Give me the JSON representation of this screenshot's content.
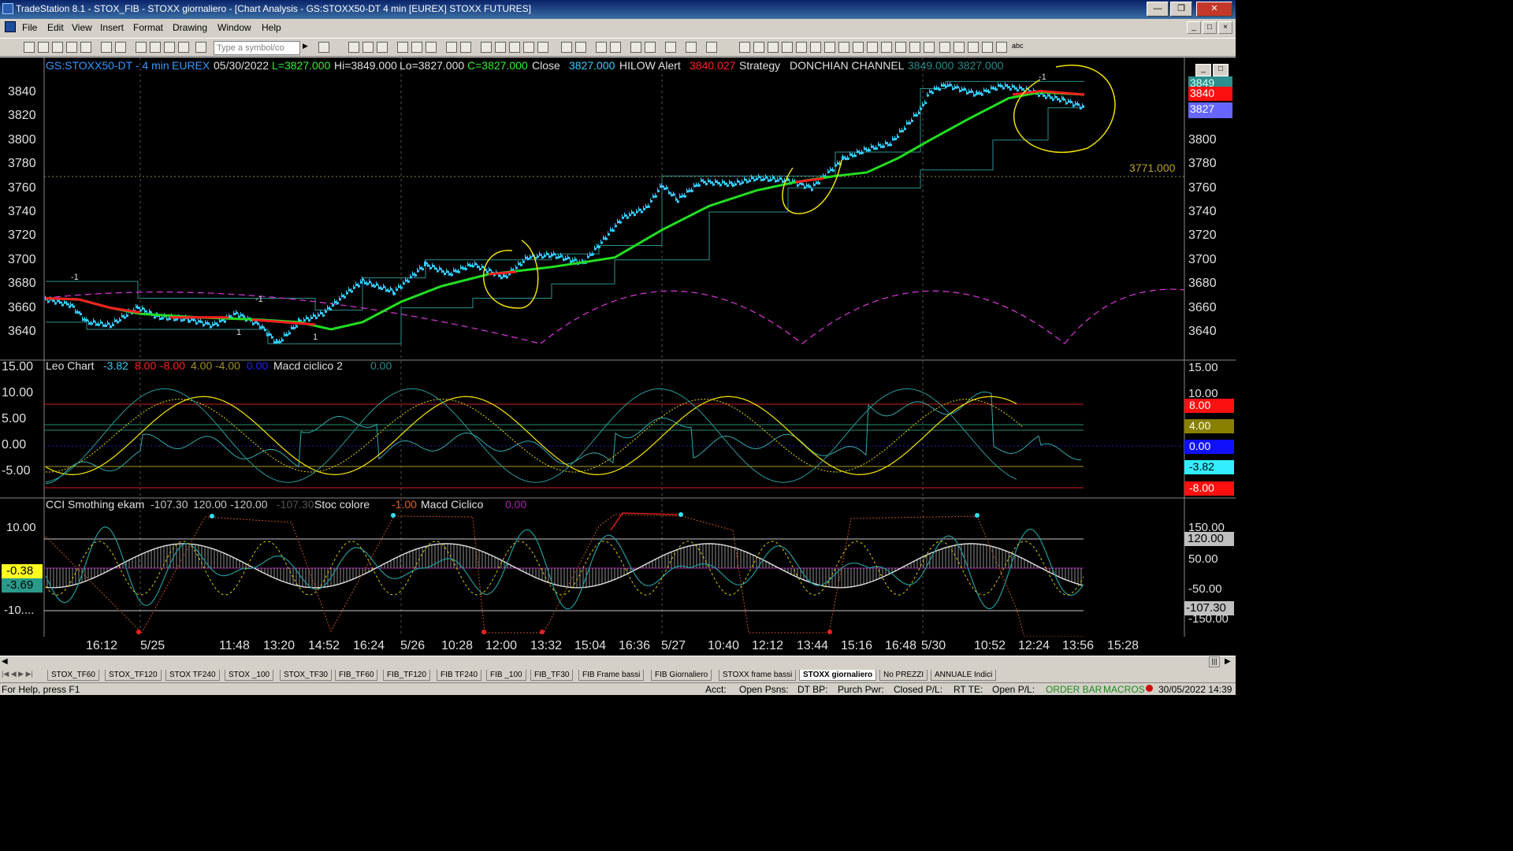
{
  "window": {
    "title": "TradeStation 8.1 - STOX_FIB - STOXX giornaliero - [Chart Analysis - GS:STOXX50-DT  4 min  [EUREX] STOXX FUTURES]"
  },
  "menu": {
    "items": [
      "File",
      "Edit",
      "View",
      "Insert",
      "Format",
      "Drawing",
      "Window",
      "Help"
    ]
  },
  "toolbar": {
    "symbol_placeholder": "Type a symbol/co",
    "text_tool": "abc"
  },
  "header": {
    "symbol": "GS:STOXX50-DT - 4 min",
    "exchange": "EUREX",
    "date": "05/30/2022",
    "low": "L=3827.000",
    "high": "Hi=3849.000",
    "lo": "Lo=3827.000",
    "close_c": "C=3827.000",
    "close_word": "Close",
    "close_val": "3827.000",
    "hilow_alert": "HILOW Alert",
    "hilow_val": "3840.027",
    "strategy": "Strategy",
    "donchian": "DONCHIAN CHANNEL",
    "donchian_hi": "3849.000",
    "donchian_lo": "3827.000"
  },
  "price_panel": {
    "y_ticks_left": [
      "3840",
      "3820",
      "3800",
      "3780",
      "3760",
      "3740",
      "3720",
      "3700",
      "3680",
      "3660",
      "3640"
    ],
    "y_ticks_right": [
      "3800",
      "3780",
      "3760",
      "3740",
      "3720",
      "3700",
      "3680",
      "3660",
      "3640"
    ],
    "badges": {
      "hi": "3849",
      "red": "3840",
      "last": "3827"
    },
    "reference_label": "3771.000",
    "signal_labels": [
      "-1",
      "-1",
      "1",
      "1",
      "-1"
    ]
  },
  "leo_panel": {
    "name": "Leo Chart",
    "values": [
      "-3.82",
      "8.00",
      "-8.00",
      "4.00",
      "-4.00",
      "0.00"
    ],
    "macd_name": "Macd ciclico 2",
    "macd_val": "0.00",
    "y_ticks_left": [
      "15.00",
      "10.00",
      "5.00",
      "0.00",
      "-5.00"
    ],
    "y_ticks_right": [
      "15.00",
      "10.00"
    ],
    "badges": [
      "8.00",
      "4.00",
      "0.00",
      "-3.82",
      "-8.00"
    ]
  },
  "cci_panel": {
    "name": "CCI Smothing ekam",
    "values": [
      "-107.30",
      "120.00",
      "-120.00",
      "-107.30"
    ],
    "stoc_name": "Stoc colore",
    "stoc_val": "-1.00",
    "macd_name": "Macd Ciclico",
    "macd_val": "0.00",
    "y_ticks_left": [
      "10.00",
      "-10...."
    ],
    "left_badges": [
      "-0.38",
      "-3.69"
    ],
    "y_ticks_right": [
      "150.00",
      "50.00",
      "-50.00",
      "-150.00"
    ],
    "right_badges": [
      "120.00",
      "-107.30"
    ]
  },
  "x_axis": {
    "labels": [
      "16:12",
      "5/25",
      "11:48",
      "13:20",
      "14:52",
      "16:24",
      "5/26",
      "10:28",
      "12:00",
      "13:32",
      "15:04",
      "16:36",
      "5/27",
      "10:40",
      "12:12",
      "13:44",
      "15:16",
      "16:48",
      "5/30",
      "10:52",
      "12:24",
      "13:56",
      "15:28"
    ]
  },
  "tabs": [
    "STOX_TF60",
    "STOX_TF120",
    "STOX TF240",
    "STOX _100",
    "STOX_TF30",
    "FIB_TF60",
    "FIB_TF120",
    "FIB TF240",
    "FIB _100",
    "FIB_TF30",
    "FIB Frame bassi",
    "FIB Giornaliero",
    "STOXX frame bassi",
    "STOXX giornaliero",
    "No PREZZI",
    "ANNUALE Indici"
  ],
  "status": {
    "help": "For Help, press F1",
    "acct": "Acct:",
    "open_psns": "Open Psns:",
    "dt_bp": "DT BP:",
    "purch_pwr": "Purch Pwr:",
    "closed_pl": "Closed P/L:",
    "rt_te": "RT TE:",
    "open_pl": "Open P/L:",
    "order_bar": "ORDER BAR",
    "macros": "MACROS",
    "datetime": "30/05/2022 14:39"
  },
  "colors": {
    "bg": "#000000",
    "price_dots": "#33ccff",
    "ma_green": "#22dd22",
    "ma_red": "#ff2020",
    "channel": "#3a9a9a",
    "cycle": "#cc33cc",
    "annot": "#f0e000",
    "cyan": "#33ddee",
    "yellow": "#e8d800"
  }
}
